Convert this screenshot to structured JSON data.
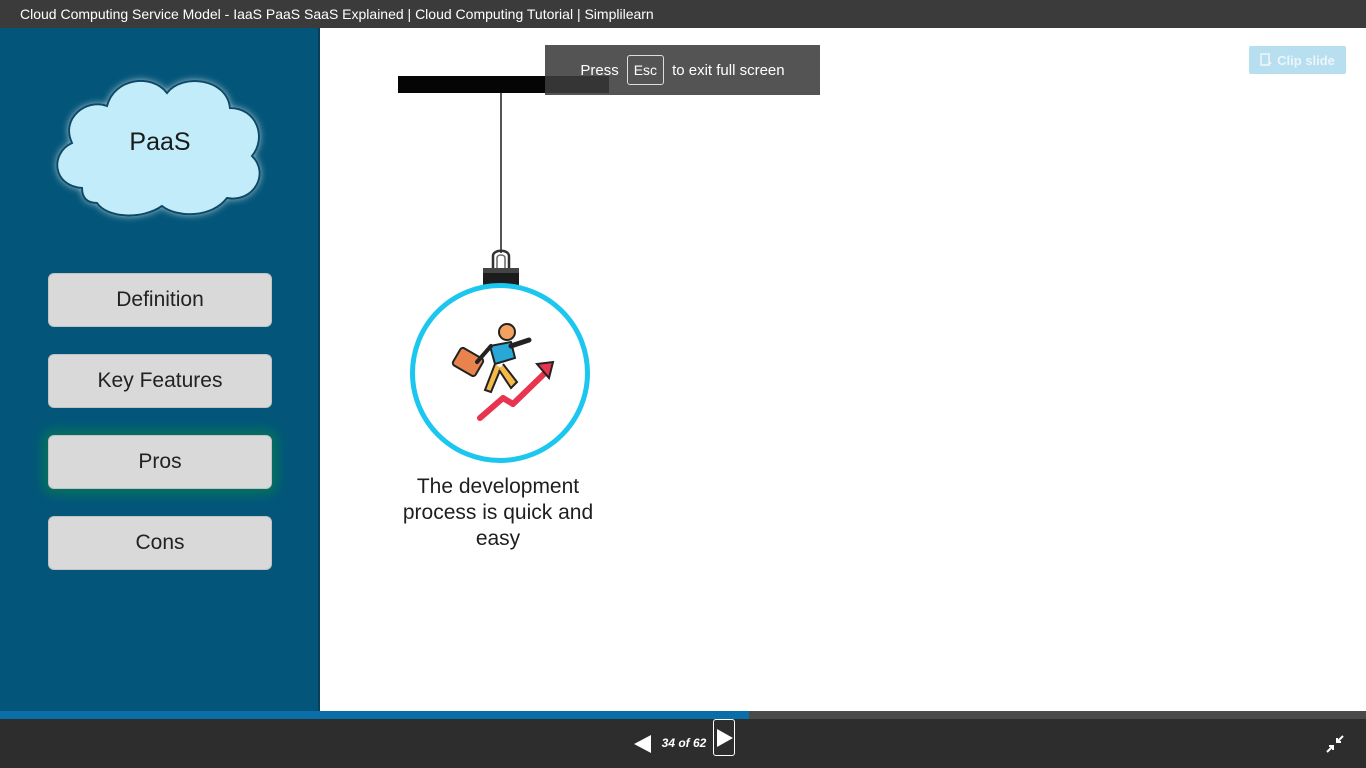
{
  "window": {
    "title": "Cloud Computing Service Model - IaaS PaaS SaaS Explained | Cloud Computing Tutorial | Simplilearn"
  },
  "sidebar": {
    "cloud_label": "PaaS",
    "items": [
      {
        "label": "Definition"
      },
      {
        "label": "Key Features"
      },
      {
        "label": "Pros"
      },
      {
        "label": "Cons"
      }
    ],
    "active_item": "Pros"
  },
  "slide": {
    "caption": "The development process is quick and easy",
    "icon": "person-climbing-growth-arrow-icon"
  },
  "fullscreen_notice": {
    "prefix": "Press",
    "key": "Esc",
    "suffix": "to exit full screen"
  },
  "toolbar": {
    "clip_label": "Clip slide"
  },
  "player": {
    "page_label": "34 of 62",
    "current_page": 34,
    "total_pages": 62,
    "progress_fraction": 0.548
  },
  "colors": {
    "sidebar_bg": "#03567a",
    "cloud_fill": "#c3ecfa",
    "ring": "#1bc6ef",
    "progress": "#0a6fa8",
    "active_glow": "#05705f"
  }
}
